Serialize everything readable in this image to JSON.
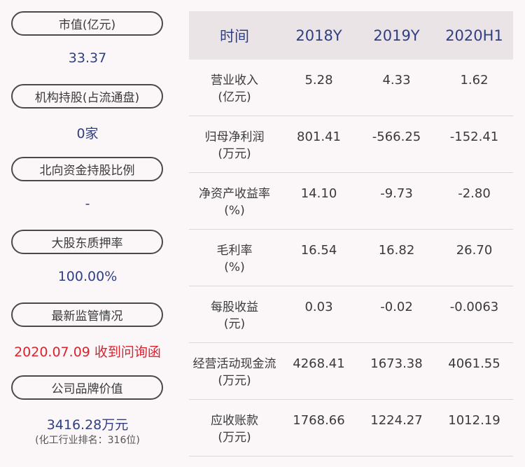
{
  "left": {
    "items": [
      {
        "label": "市值(亿元)",
        "value": "33.37"
      },
      {
        "label": "机构持股(占流通盘)",
        "value": "0家"
      },
      {
        "label": "北向资金持股比例",
        "value": "-"
      },
      {
        "label": "大股东质押率",
        "value": "100.00%"
      },
      {
        "label": "最新监管情况",
        "value": "2020.07.09 收到问询函"
      },
      {
        "label": "公司品牌价值",
        "value": "3416.28万元",
        "sub": "(化工行业排名：316位)"
      }
    ]
  },
  "table": {
    "header": [
      "时间",
      "2018Y",
      "2019Y",
      "2020H1"
    ],
    "rows": [
      {
        "name": "营业收入",
        "unit": "(亿元)",
        "values": [
          "5.28",
          "4.33",
          "1.62"
        ]
      },
      {
        "name": "归母净利润",
        "unit": "(万元)",
        "values": [
          "801.41",
          "-566.25",
          "-152.41"
        ]
      },
      {
        "name": "净资产收益率",
        "unit": "(%)",
        "values": [
          "14.10",
          "-9.73",
          "-2.80"
        ]
      },
      {
        "name": "毛利率",
        "unit": "(%)",
        "values": [
          "16.54",
          "16.82",
          "26.70"
        ]
      },
      {
        "name": "每股收益",
        "unit": "(元)",
        "values": [
          "0.03",
          "-0.02",
          "-0.0063"
        ]
      },
      {
        "name": "经营活动现金流",
        "unit": "(万元)",
        "values": [
          "4268.41",
          "1673.38",
          "4061.55"
        ]
      },
      {
        "name": "应收账款",
        "unit": "(万元)",
        "values": [
          "1768.66",
          "1224.27",
          "1012.19"
        ]
      }
    ]
  },
  "colors": {
    "background": "#fbf6f8",
    "value_blue": "#2f3f83",
    "alert_red": "#d8242f",
    "header_bg": "#ebe4e7"
  }
}
